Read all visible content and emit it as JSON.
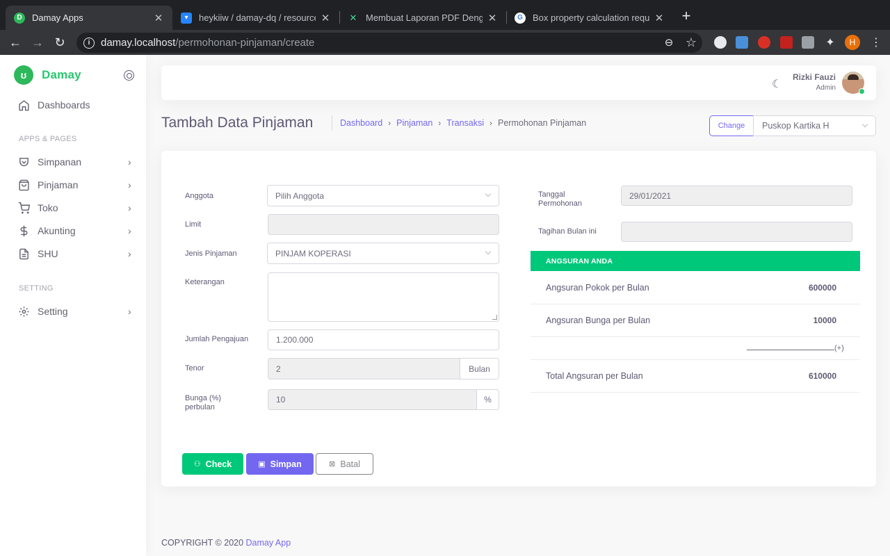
{
  "browser": {
    "tabs": [
      {
        "title": "Damay Apps",
        "active": true
      },
      {
        "title": "heykiiw / damay-dq / resources",
        "active": false
      },
      {
        "title": "Membuat Laporan PDF Dengan",
        "active": false
      },
      {
        "title": "Box property calculation requir",
        "active": false
      }
    ],
    "url_host": "damay.localhost",
    "url_path": "/permohonan-pinjaman/create",
    "profile_initial": "H"
  },
  "sidebar": {
    "brand": "Damay",
    "dashboards": "Dashboards",
    "apps_header": "APPS & PAGES",
    "items": [
      "Simpanan",
      "Pinjaman",
      "Toko",
      "Akunting",
      "SHU"
    ],
    "setting_header": "SETTING",
    "setting": "Setting"
  },
  "navbar": {
    "user_name": "Rizki Fauzi",
    "user_role": "Admin"
  },
  "page": {
    "title": "Tambah Data Pinjaman",
    "breadcrumb": [
      "Dashboard",
      "Pinjaman",
      "Transaksi",
      "Permohonan Pinjaman"
    ],
    "change_label": "Change",
    "koperasi": "Puskop Kartika H"
  },
  "form": {
    "anggota_label": "Anggota",
    "anggota_value": "Pilih Anggota",
    "limit_label": "Limit",
    "limit_value": "",
    "jenis_label": "Jenis Pinjaman",
    "jenis_value": "PINJAM KOPERASI",
    "keterangan_label": "Keterangan",
    "keterangan_value": "",
    "jumlah_label": "Jumlah Pengajuan",
    "jumlah_value": "1.200.000",
    "tenor_label": "Tenor",
    "tenor_value": "2",
    "tenor_unit": "Bulan",
    "bunga_label_1": "Bunga (%)",
    "bunga_label_2": "perbulan",
    "bunga_value": "10",
    "bunga_unit": "%",
    "tanggal_label_1": "Tanggal",
    "tanggal_label_2": "Permohonan",
    "tanggal_value": "29/01/2021",
    "tagihan_label": "Tagihan Bulan ini",
    "tagihan_value": ""
  },
  "angsuran": {
    "header": "ANGSURAN ANDA",
    "pokok_label": "Angsuran Pokok per Bulan",
    "pokok_value": "600000",
    "bunga_label": "Angsuran Bunga per Bulan",
    "bunga_value": "10000",
    "plus": "(+)",
    "total_label": "Total Angsuran per Bulan",
    "total_value": "610000"
  },
  "buttons": {
    "check": "Check",
    "save": "Simpan",
    "cancel": "Batal"
  },
  "footer": {
    "text": "COPYRIGHT © 2020 ",
    "link": "Damay App"
  },
  "colors": {
    "primary": "#7367f0",
    "success": "#00c87a",
    "brand": "#28c76f"
  }
}
